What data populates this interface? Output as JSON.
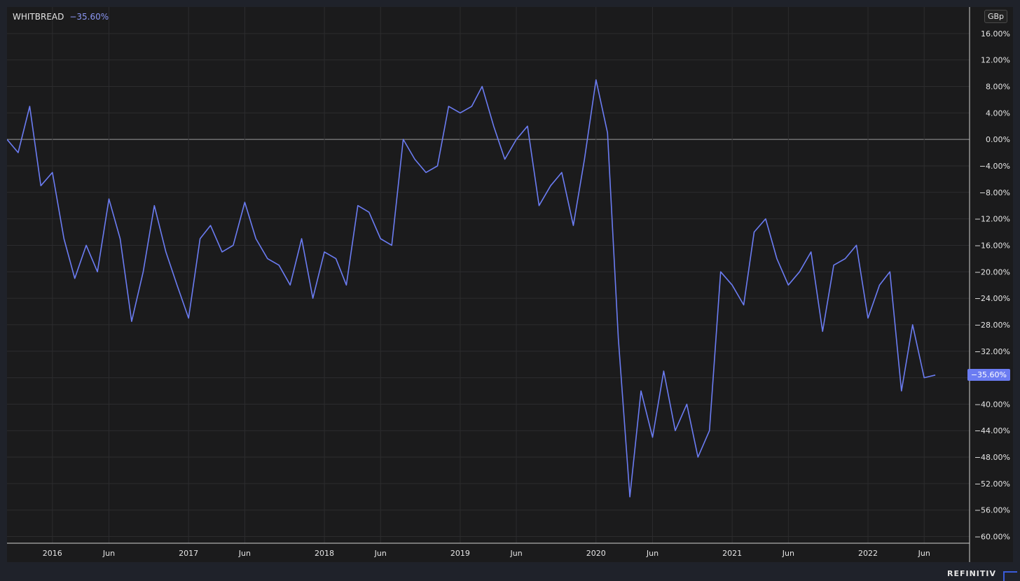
{
  "legend": {
    "symbol": "WHITBREAD",
    "change": "−35.60%"
  },
  "unit_badge": "GBp",
  "last_value_label": "−35.60%",
  "brand": "REFINITIV",
  "colors": {
    "series": "#6b7cf2",
    "background": "#1b1b1c",
    "grid": "#2c2c2e",
    "zero_line": "#9a9a9a"
  },
  "chart_data": {
    "type": "line",
    "series": [
      {
        "name": "WHITBREAD",
        "color": "#6b7cf2",
        "x": [
          "2015-09-01",
          "2015-10-01",
          "2015-11-01",
          "2015-12-01",
          "2016-01-01",
          "2016-02-01",
          "2016-03-01",
          "2016-04-01",
          "2016-05-01",
          "2016-06-01",
          "2016-07-01",
          "2016-08-01",
          "2016-09-01",
          "2016-10-01",
          "2016-11-01",
          "2016-12-01",
          "2017-01-01",
          "2017-02-01",
          "2017-03-01",
          "2017-04-01",
          "2017-05-01",
          "2017-06-01",
          "2017-07-01",
          "2017-08-01",
          "2017-09-01",
          "2017-10-01",
          "2017-11-01",
          "2017-12-01",
          "2018-01-01",
          "2018-02-01",
          "2018-03-01",
          "2018-04-01",
          "2018-05-01",
          "2018-06-01",
          "2018-07-01",
          "2018-08-01",
          "2018-09-01",
          "2018-10-01",
          "2018-11-01",
          "2018-12-01",
          "2019-01-01",
          "2019-02-01",
          "2019-03-01",
          "2019-04-01",
          "2019-05-01",
          "2019-06-01",
          "2019-07-01",
          "2019-08-01",
          "2019-09-01",
          "2019-10-01",
          "2019-11-01",
          "2019-12-01",
          "2020-01-01",
          "2020-02-01",
          "2020-03-01",
          "2020-04-01",
          "2020-05-01",
          "2020-06-01",
          "2020-07-01",
          "2020-08-01",
          "2020-09-01",
          "2020-10-01",
          "2020-11-01",
          "2020-12-01",
          "2021-01-01",
          "2021-02-01",
          "2021-03-01",
          "2021-04-01",
          "2021-05-01",
          "2021-06-01",
          "2021-07-01",
          "2021-08-01",
          "2021-09-01",
          "2021-10-01",
          "2021-11-01",
          "2021-12-01",
          "2022-01-01",
          "2022-02-01",
          "2022-03-01",
          "2022-04-01",
          "2022-05-01",
          "2022-06-01",
          "2022-07-01"
        ],
        "y": [
          0.0,
          -2.0,
          5.0,
          -7.0,
          -5.0,
          -15.0,
          -21.0,
          -16.0,
          -20.0,
          -9.0,
          -15.0,
          -27.5,
          -20.0,
          -10.0,
          -17.0,
          -22.0,
          -27.0,
          -15.0,
          -13.0,
          -17.0,
          -16.0,
          -9.5,
          -15.0,
          -18.0,
          -19.0,
          -22.0,
          -15.0,
          -24.0,
          -17.0,
          -18.0,
          -22.0,
          -10.0,
          -11.0,
          -15.0,
          -16.0,
          0.0,
          -3.0,
          -5.0,
          -4.0,
          5.0,
          4.0,
          5.0,
          8.0,
          2.0,
          -3.0,
          0.0,
          2.0,
          -10.0,
          -7.0,
          -5.0,
          -13.0,
          -3.0,
          9.0,
          1.0,
          -30.0,
          -54.0,
          -38.0,
          -45.0,
          -35.0,
          -44.0,
          -40.0,
          -48.0,
          -44.0,
          -20.0,
          -22.0,
          -25.0,
          -14.0,
          -12.0,
          -18.0,
          -22.0,
          -20.0,
          -17.0,
          -29.0,
          -19.0,
          -18.0,
          -16.0,
          -27.0,
          -22.0,
          -20.0,
          -38.0,
          -28.0,
          -36.0,
          -35.6
        ]
      }
    ],
    "x_tick_labels": [
      "2016",
      "Jun",
      "2017",
      "Jun",
      "2018",
      "Jun",
      "2019",
      "Jun",
      "2020",
      "Jun",
      "2021",
      "Jun",
      "2022",
      "Jun"
    ],
    "x_ticks": [
      "2016-01-01",
      "2016-06-01",
      "2017-01-01",
      "2017-06-01",
      "2018-01-01",
      "2018-06-01",
      "2019-01-01",
      "2019-06-01",
      "2020-01-01",
      "2020-06-01",
      "2021-01-01",
      "2021-06-01",
      "2022-01-01",
      "2022-06-01"
    ],
    "y_tick_labels": [
      "16.00%",
      "12.00%",
      "8.00%",
      "4.00%",
      "0.00%",
      "−4.00%",
      "−8.00%",
      "−12.00%",
      "−16.00%",
      "−20.00%",
      "−24.00%",
      "−28.00%",
      "−32.00%",
      "−36.00%",
      "−40.00%",
      "−44.00%",
      "−48.00%",
      "−52.00%",
      "−56.00%",
      "−60.00%"
    ],
    "y_ticks": [
      16,
      12,
      8,
      4,
      0,
      -4,
      -8,
      -12,
      -16,
      -20,
      -24,
      -28,
      -32,
      -36,
      -40,
      -44,
      -48,
      -52,
      -56,
      -60
    ],
    "xlim": [
      "2015-09-01",
      "2022-10-01"
    ],
    "ylim": [
      -61,
      20
    ],
    "grid": true,
    "y_axis_position": "right"
  }
}
